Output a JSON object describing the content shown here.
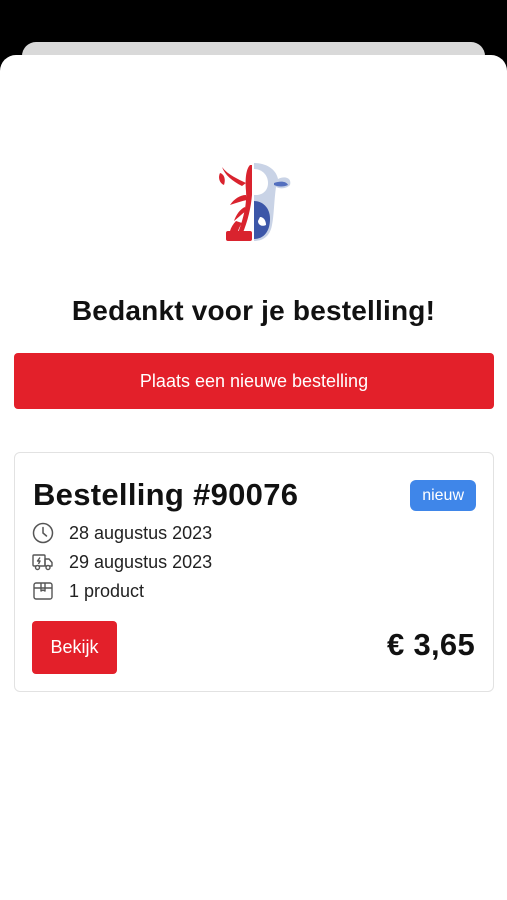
{
  "brand": {
    "logo_icon": "lobster-cow-logo-icon",
    "accent_color": "#e3202a"
  },
  "heading": "Bedankt voor je bestelling!",
  "new_order_button": "Plaats een nieuwe bestelling",
  "order": {
    "title": "Bestelling #90076",
    "status_badge": "nieuw",
    "status_color": "#3f86e9",
    "order_date": "28 augustus 2023",
    "order_date_icon": "clock-icon",
    "delivery_date": "29 augustus 2023",
    "delivery_date_icon": "delivery-truck-icon",
    "product_count": "1 product",
    "product_count_icon": "package-icon",
    "view_button": "Bekijk",
    "total": "€ 3,65"
  }
}
